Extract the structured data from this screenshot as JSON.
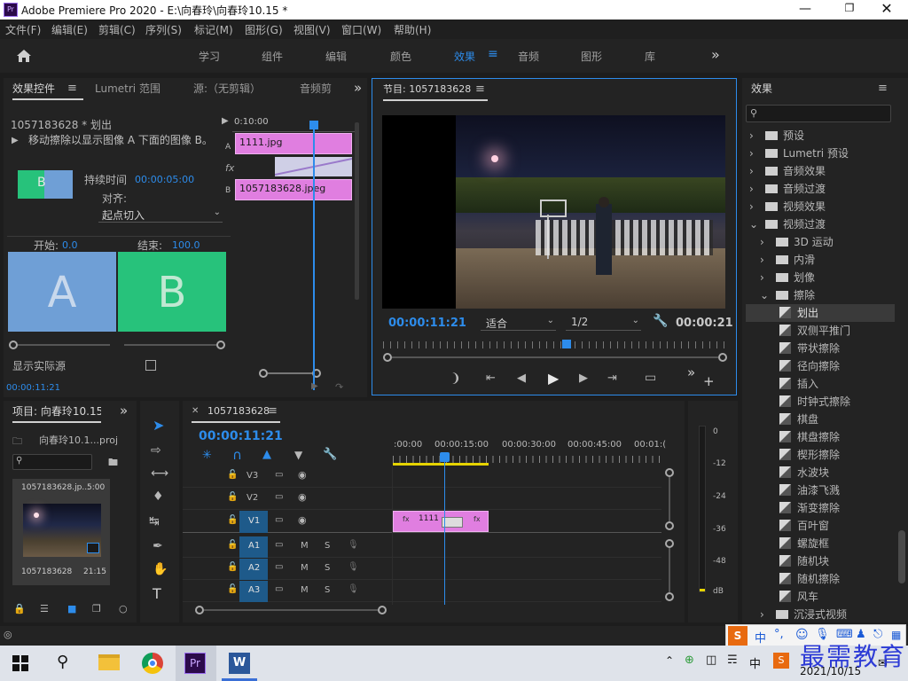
{
  "window": {
    "title": "Adobe Premiere Pro 2020 - E:\\向春玲\\向春玲10.15 *"
  },
  "menu": [
    "文件(F)",
    "编辑(E)",
    "剪辑(C)",
    "序列(S)",
    "标记(M)",
    "图形(G)",
    "视图(V)",
    "窗口(W)",
    "帮助(H)"
  ],
  "workspaces": [
    "学习",
    "组件",
    "编辑",
    "颜色",
    "效果",
    "音频",
    "图形",
    "库"
  ],
  "active_workspace": "效果",
  "effect_controls": {
    "tabs": [
      "效果控件",
      "Lumetri 范围",
      "源:（无剪辑）",
      "音频剪"
    ],
    "clip_name": "1057183628 * 划出",
    "timecode_head": "0:10:00",
    "description": "移动擦除以显示图像 A 下面的图像 B。",
    "duration_label": "持续时间",
    "duration_value": "00:00:05:00",
    "align_label": "对齐:",
    "align_value": "起点切入",
    "clip_a": "1111.jpg",
    "clip_b": "1057183628.jpeg",
    "start_label": "开始:",
    "start_value": "0.0",
    "end_label": "结束:",
    "end_value": "100.0",
    "letter_a": "A",
    "letter_b": "B",
    "show_actual_sources": "显示实际源",
    "current_time": "00:00:11:21",
    "thumb_letter": "B"
  },
  "program": {
    "title": "节目: 1057183628",
    "timecode": "00:00:11:21",
    "fit": "适合",
    "resolution": "1/2",
    "duration": "00:00:21"
  },
  "project": {
    "title": "项目: 向春玲10.15",
    "file": "向春玲10.1...proj",
    "clip_name_top": "1057183628.jp...",
    "clip_dur_top": "5:00",
    "clip_name": "1057183628",
    "clip_dur": "21:15"
  },
  "timeline": {
    "title": "1057183628",
    "timecode": "00:00:11:21",
    "ruler": [
      ":00:00",
      "00:00:15:00",
      "00:00:30:00",
      "00:00:45:00",
      "00:01:("
    ],
    "tracks": [
      "V3",
      "V2",
      "V1",
      "A1",
      "A2",
      "A3"
    ],
    "m_label": "M",
    "s_label": "S",
    "clip_label": "1111"
  },
  "meter": {
    "scale": [
      "0",
      "-12",
      "-24",
      "-36",
      "-48",
      "dB"
    ]
  },
  "effects": {
    "title": "效果",
    "items": [
      {
        "label": "预设",
        "level": 0,
        "type": "bin-star"
      },
      {
        "label": "Lumetri 预设",
        "level": 0,
        "type": "bin-star"
      },
      {
        "label": "音频效果",
        "level": 0,
        "type": "bin"
      },
      {
        "label": "音频过渡",
        "level": 0,
        "type": "bin"
      },
      {
        "label": "视频效果",
        "level": 0,
        "type": "bin"
      },
      {
        "label": "视频过渡",
        "level": 0,
        "type": "bin-open"
      },
      {
        "label": "3D 运动",
        "level": 1,
        "type": "bin"
      },
      {
        "label": "内滑",
        "level": 1,
        "type": "bin"
      },
      {
        "label": "划像",
        "level": 1,
        "type": "bin"
      },
      {
        "label": "擦除",
        "level": 1,
        "type": "bin-open"
      },
      {
        "label": "划出",
        "level": 2,
        "type": "fx",
        "selected": true
      },
      {
        "label": "双侧平推门",
        "level": 2,
        "type": "fx"
      },
      {
        "label": "带状擦除",
        "level": 2,
        "type": "fx"
      },
      {
        "label": "径向擦除",
        "level": 2,
        "type": "fx"
      },
      {
        "label": "插入",
        "level": 2,
        "type": "fx"
      },
      {
        "label": "时钟式擦除",
        "level": 2,
        "type": "fx"
      },
      {
        "label": "棋盘",
        "level": 2,
        "type": "fx"
      },
      {
        "label": "棋盘擦除",
        "level": 2,
        "type": "fx"
      },
      {
        "label": "楔形擦除",
        "level": 2,
        "type": "fx"
      },
      {
        "label": "水波块",
        "level": 2,
        "type": "fx"
      },
      {
        "label": "油漆飞溅",
        "level": 2,
        "type": "fx"
      },
      {
        "label": "渐变擦除",
        "level": 2,
        "type": "fx"
      },
      {
        "label": "百叶窗",
        "level": 2,
        "type": "fx"
      },
      {
        "label": "螺旋框",
        "level": 2,
        "type": "fx"
      },
      {
        "label": "随机块",
        "level": 2,
        "type": "fx"
      },
      {
        "label": "随机擦除",
        "level": 2,
        "type": "fx"
      },
      {
        "label": "风车",
        "level": 2,
        "type": "fx"
      },
      {
        "label": "沉浸式视频",
        "level": 1,
        "type": "bin"
      }
    ]
  },
  "ime": {
    "s_logo": "S",
    "lang": "中",
    "punct": "°,"
  },
  "watermark": "最需教育",
  "taskbar": {
    "date": "2021/10/15",
    "tray_lang": "中",
    "pr_label": "Pr",
    "w_label": "W"
  },
  "colors": {
    "accent": "#2d8ceb",
    "clip": "#e07ee0",
    "panel": "#232323",
    "active_border": "#2d8ceb"
  }
}
